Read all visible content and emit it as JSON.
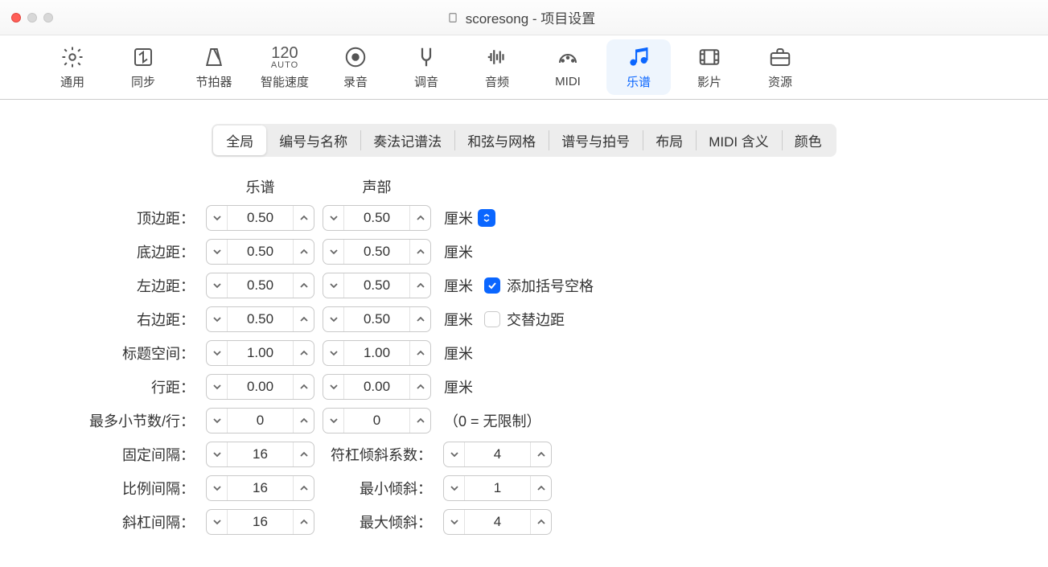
{
  "window": {
    "title": "scoresong - 项目设置"
  },
  "toolbar": {
    "items": [
      {
        "label": "通用"
      },
      {
        "label": "同步"
      },
      {
        "label": "节拍器"
      },
      {
        "label": "智能速度"
      },
      {
        "label": "录音"
      },
      {
        "label": "调音"
      },
      {
        "label": "音频"
      },
      {
        "label": "MIDI"
      },
      {
        "label": "乐谱"
      },
      {
        "label": "影片"
      },
      {
        "label": "资源"
      }
    ],
    "tempo_icon_top": "120",
    "tempo_icon_bottom": "AUTO"
  },
  "tabs": [
    "全局",
    "编号与名称",
    "奏法记谱法",
    "和弦与网格",
    "谱号与拍号",
    "布局",
    "MIDI 含义",
    "颜色"
  ],
  "columns": {
    "score": "乐谱",
    "part": "声部"
  },
  "units": {
    "cm": "厘米"
  },
  "rows": {
    "top": {
      "label": "顶边距：",
      "score": "0.50",
      "part": "0.50",
      "unit": "厘米",
      "select": true
    },
    "bottom": {
      "label": "底边距：",
      "score": "0.50",
      "part": "0.50",
      "unit": "厘米"
    },
    "left": {
      "label": "左边距：",
      "score": "0.50",
      "part": "0.50",
      "unit": "厘米",
      "chk": true,
      "chklabel": "添加括号空格",
      "chkval": true
    },
    "right": {
      "label": "右边距：",
      "score": "0.50",
      "part": "0.50",
      "unit": "厘米",
      "chk": true,
      "chklabel": "交替边距",
      "chkval": false
    },
    "header": {
      "label": "标题空间：",
      "score": "1.00",
      "part": "1.00",
      "unit": "厘米"
    },
    "linesp": {
      "label": "行距：",
      "score": "0.00",
      "part": "0.00",
      "unit": "厘米"
    },
    "maxbar": {
      "label": "最多小节数/行：",
      "score": "0",
      "part": "0",
      "note": "（0 = 无限制）"
    },
    "fixed": {
      "label": "固定间隔：",
      "score": "16",
      "rlabel": "符杠倾斜系数：",
      "rval": "4"
    },
    "prop": {
      "label": "比例间隔：",
      "score": "16",
      "rlabel": "最小倾斜：",
      "rval": "1"
    },
    "slash": {
      "label": "斜杠间隔：",
      "score": "16",
      "rlabel": "最大倾斜：",
      "rval": "4"
    }
  }
}
